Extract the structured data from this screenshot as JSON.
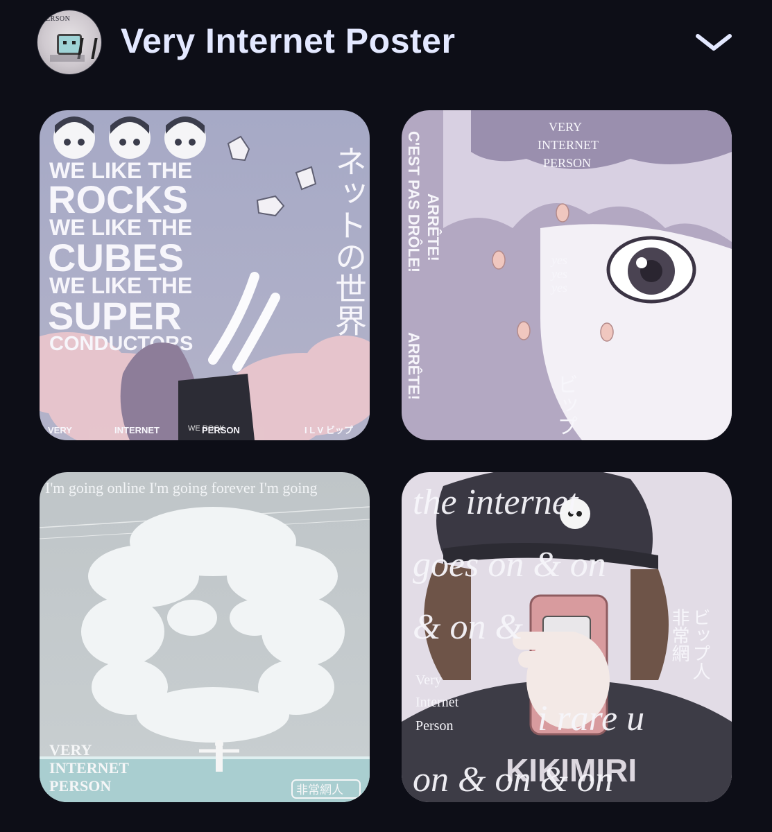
{
  "header": {
    "title": "Very Internet Poster",
    "avatar_text": "PERSON",
    "expand_icon": "chevron-down-icon"
  },
  "posters": [
    {
      "lines": [
        "WE LIKE THE",
        "ROCKS",
        "WE LIKE THE",
        "CUBES",
        "WE LIKE THE",
        "SUPER",
        "CONDUCTORS"
      ],
      "jp_vertical": "ネットの世界",
      "footer": [
        "VERY",
        "INTERNET",
        "PERSON",
        "I L V ビップ"
      ],
      "shirt_text": "WE ROCK"
    },
    {
      "credit": [
        "VERY",
        "INTERNET",
        "PERSON"
      ],
      "side_texts": [
        "C'EST PAS DRÔLE!",
        "ARRÊTE!",
        "ARRÊTE!"
      ],
      "yes": [
        "yes",
        "yes",
        "yes"
      ],
      "jp_vertical": "ビップ"
    },
    {
      "top_text": "I'm going online I'm going forever I'm going",
      "credit": [
        "VERY",
        "INTERNET",
        "PERSON"
      ],
      "badge": "非常網人"
    },
    {
      "lines": [
        "the  internet",
        "goes on & on",
        "& on &",
        "i rare u",
        "on & on & on"
      ],
      "credit": [
        "Very",
        "Internet",
        "Person"
      ],
      "jp_col1": "ビップ人",
      "jp_col2": "非常網",
      "shirt_text": "KIKIMIRI"
    }
  ]
}
